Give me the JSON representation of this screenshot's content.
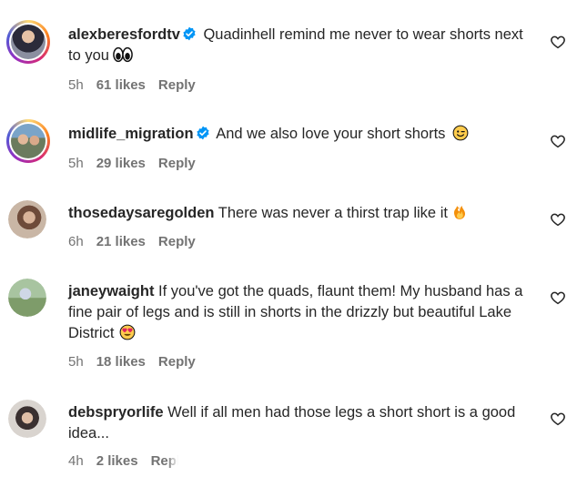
{
  "comments": [
    {
      "username": "alexberesfordtv",
      "verified": true,
      "story_ring": true,
      "text": "Quadinhell remind me never to wear shorts next to you",
      "emoji": "eyes-emoji",
      "time": "5h",
      "likes": "61 likes",
      "reply": "Reply"
    },
    {
      "username": "midlife_migration",
      "verified": true,
      "story_ring": true,
      "text": "And we also love your short shorts",
      "emoji": "wink-emoji",
      "time": "5h",
      "likes": "29 likes",
      "reply": "Reply"
    },
    {
      "username": "thosedaysaregolden",
      "verified": false,
      "story_ring": false,
      "text": "There was never a thirst trap like it",
      "emoji": "fire-emoji",
      "time": "6h",
      "likes": "21 likes",
      "reply": "Reply"
    },
    {
      "username": "janeywaight",
      "verified": false,
      "story_ring": false,
      "text": "If you've got the quads, flaunt them! My husband has a fine pair of legs and is still in shorts in the drizzly but beautiful Lake District",
      "emoji": "heart-eyes-emoji",
      "time": "5h",
      "likes": "18 likes",
      "reply": "Reply"
    },
    {
      "username": "debspryorlife",
      "verified": false,
      "story_ring": false,
      "text": "Well if all men had those legs a short short is a good idea...",
      "emoji": "",
      "time": "4h",
      "likes": "2 likes",
      "reply": "Reply"
    }
  ],
  "colors": {
    "text": "#262626",
    "meta": "#737373",
    "verified_badge": "#0095f6"
  }
}
